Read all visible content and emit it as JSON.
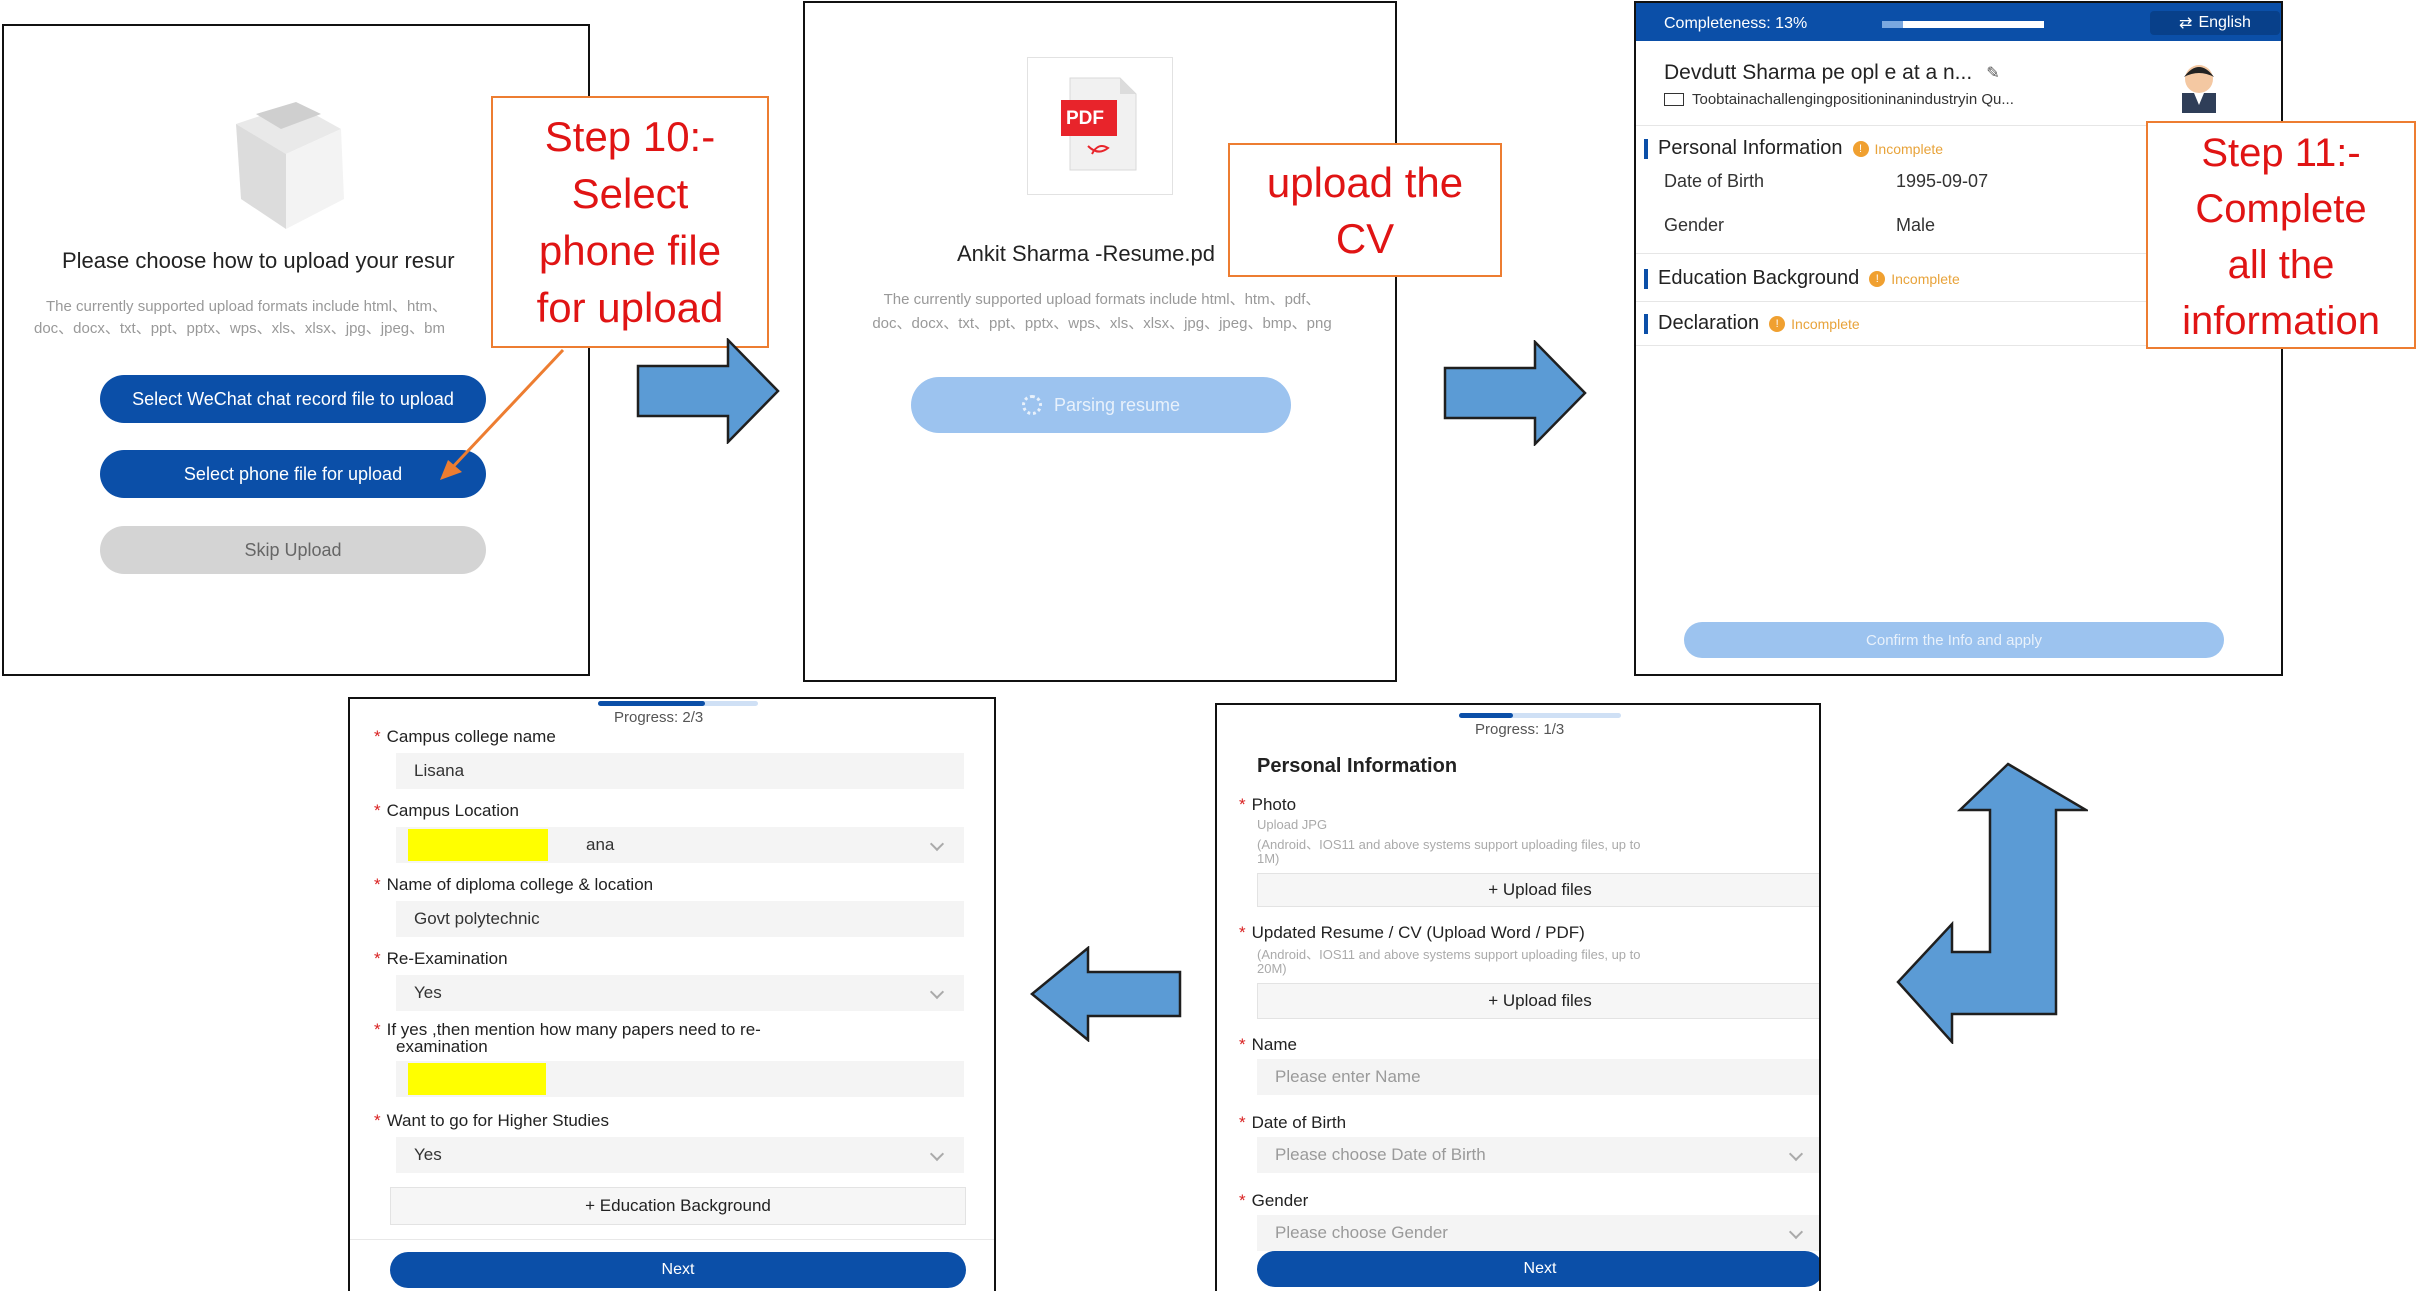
{
  "panel1": {
    "heading": "Please choose how to upload your resur",
    "formats_line1": "The currently supported upload formats include html、htm、",
    "formats_line2": "doc、docx、txt、ppt、pptx、wps、xls、xlsx、jpg、jpeg、bm",
    "btn_wechat": "Select WeChat chat record file to upload",
    "btn_phone": "Select phone file for upload",
    "btn_skip": "Skip Upload"
  },
  "callout1": {
    "line1": "Step 10:-",
    "line2": "Select",
    "line3": "phone file",
    "line4": "for upload"
  },
  "panel2": {
    "pdf_label": "PDF",
    "filename": "Ankit Sharma -Resume.pd",
    "formats_line1": "The currently supported upload formats include html、htm、pdf、",
    "formats_line2": "doc、docx、txt、ppt、pptx、wps、xls、xlsx、jpg、jpeg、bmp、png",
    "parsing": "Parsing resume"
  },
  "callout2": {
    "line1": "upload the",
    "line2": "CV"
  },
  "panel3": {
    "completeness_label": "Completeness: 13%",
    "completeness_value": 0.13,
    "language": "English",
    "name_line": "Devdutt Sharma pe opl e at a n...",
    "objective": "Toobtainachallengingpositioninanindustryin Qu...",
    "sec_personal": "Personal Information",
    "dob_label": "Date of Birth",
    "dob_value": "1995-09-07",
    "gender_label": "Gender",
    "gender_value": "Male",
    "sec_education": "Education Background",
    "sec_declaration": "Declaration",
    "status_incomplete": "Incomplete",
    "confirm_btn": "Confirm the Info and apply"
  },
  "callout3": {
    "line1": "Step 11:-",
    "line2": "Complete",
    "line3": "all the",
    "line4": "information"
  },
  "panel4": {
    "progress": "Progress: 1/3",
    "progress_value": 0.333,
    "section": "Personal Information",
    "photo_label": "Photo",
    "photo_hint1": "Upload JPG",
    "photo_hint2": "(Android、IOS11 and above systems support uploading files, up to",
    "photo_hint3": "1M)",
    "upload_files": "+ Upload files",
    "resume_label": "Updated Resume / CV (Upload Word / PDF)",
    "resume_hint1": "(Android、IOS11 and above systems support uploading files, up to",
    "resume_hint2": "20M)",
    "name_label": "Name",
    "name_ph": "Please enter Name",
    "dob_label": "Date of Birth",
    "dob_ph": "Please choose Date of Birth",
    "gender_label": "Gender",
    "gender_ph": "Please choose Gender",
    "next": "Next"
  },
  "panel5": {
    "progress": "Progress: 2/3",
    "progress_value": 0.667,
    "college_label": "Campus college name",
    "college_value": "Lisana",
    "location_label": "Campus Location",
    "location_value": "ana",
    "diploma_label": "Name of diploma college & location",
    "diploma_value": "Govt polytechnic",
    "reexam_label": "Re-Examination",
    "reexam_value": "Yes",
    "papers_label1": "If yes ,then mention how many papers need to re-",
    "papers_label2": "examination",
    "higher_label": "Want to go for Higher Studies",
    "higher_value": "Yes",
    "add_edu": "+ Education Background",
    "next": "Next"
  },
  "colors": {
    "brand_blue": "#0b4fa8",
    "arrow_blue": "#5b9bd5",
    "callout_border": "#ed7d31",
    "callout_text": "#e01414",
    "incomplete": "#f0a030"
  }
}
